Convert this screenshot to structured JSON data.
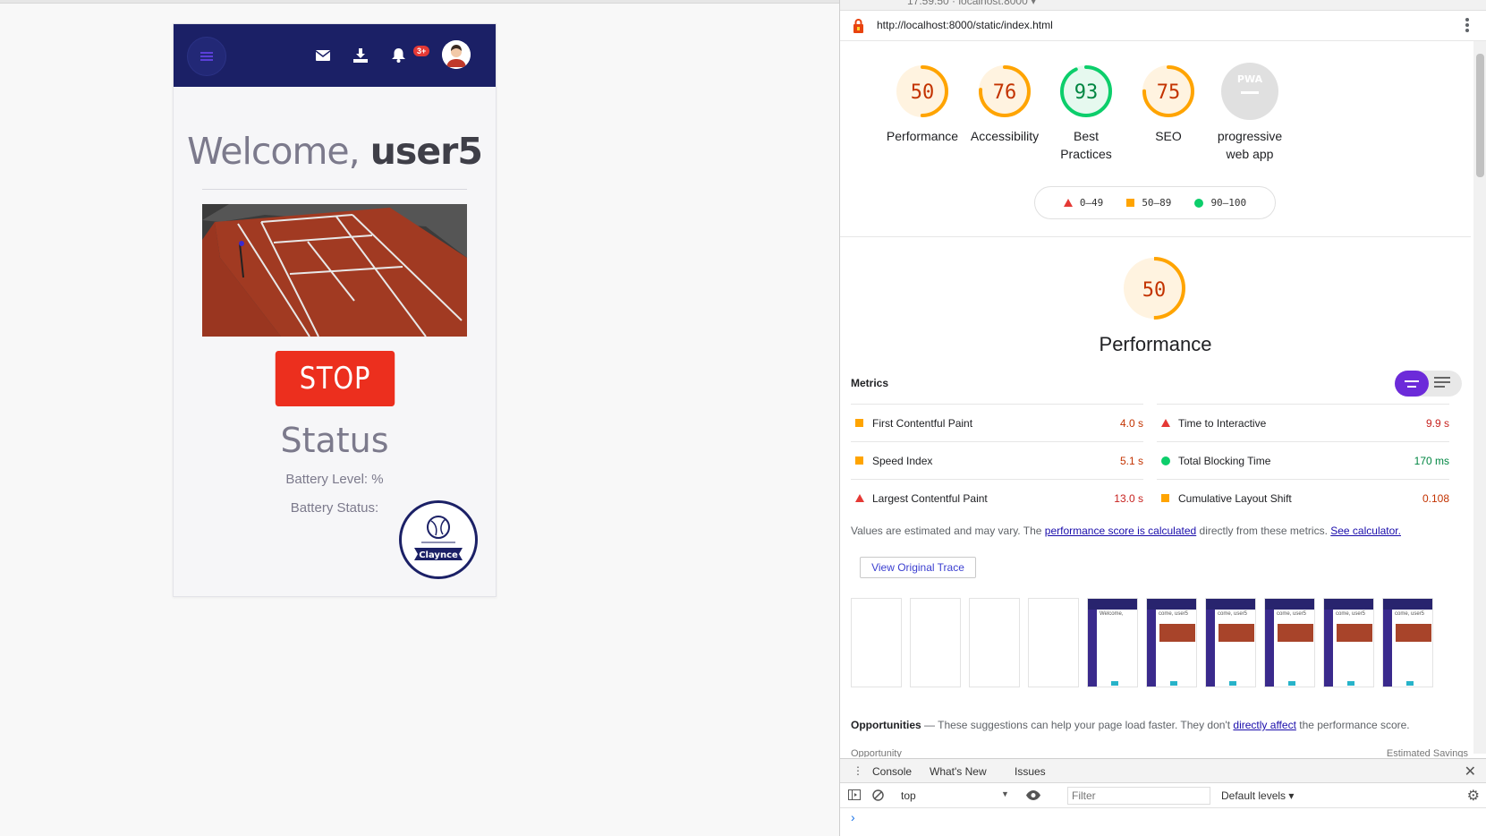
{
  "app": {
    "welcome_prefix": "Welcome,",
    "username": "user5",
    "notification_badge": "3+",
    "stop_label": "STOP",
    "status_title": "Status",
    "battery_level_label": "Battery Level:  %",
    "battery_status_label": "Battery Status:",
    "logo_text": "Claynce",
    "colors": {
      "navbar": "#1b2066",
      "stop": "#ec2f1e"
    }
  },
  "devtools": {
    "url": "http://localhost:8000/static/index.html",
    "top_partial": "17:59:50 · localhost:8000 ▾",
    "scores": [
      {
        "value": 50,
        "label": "Performance",
        "color": "#ffa400"
      },
      {
        "value": 76,
        "label": "Accessibility",
        "color": "#ffa400"
      },
      {
        "value": 93,
        "label": "Best Practices",
        "color": "#0cce6b"
      },
      {
        "value": 75,
        "label": "SEO",
        "color": "#ffa400"
      },
      {
        "value": null,
        "label": "progressive web app",
        "color": "#cccccc",
        "badge": "PWA"
      }
    ],
    "legend": {
      "red": "0–49",
      "orange": "50–89",
      "green": "90–100"
    },
    "performance": {
      "value": 50,
      "title": "Performance"
    },
    "metrics_heading": "Metrics",
    "metrics": [
      {
        "name": "First Contentful Paint",
        "value": "4.0 s",
        "rating": "average"
      },
      {
        "name": "Time to Interactive",
        "value": "9.9 s",
        "rating": "fail"
      },
      {
        "name": "Speed Index",
        "value": "5.1 s",
        "rating": "average"
      },
      {
        "name": "Total Blocking Time",
        "value": "170 ms",
        "rating": "pass"
      },
      {
        "name": "Largest Contentful Paint",
        "value": "13.0 s",
        "rating": "fail"
      },
      {
        "name": "Cumulative Layout Shift",
        "value": "0.108",
        "rating": "average"
      }
    ],
    "note": {
      "prefix": "Values are estimated and may vary. The ",
      "link1": "performance score is calculated",
      "middle": " directly from these metrics. ",
      "link2": "See calculator."
    },
    "trace_button": "View Original Trace",
    "thumbs_text": [
      "Welcome,",
      "come, user5"
    ],
    "opportunities": {
      "title": "Opportunities",
      "dash": " — ",
      "text": "These suggestions can help your page load faster. They don't ",
      "link": "directly affect",
      "suffix": " the performance score.",
      "col_left": "Opportunity",
      "col_right": "Estimated Savings"
    },
    "console": {
      "tabs": [
        "Console",
        "What's New",
        "Issues"
      ],
      "context": "top",
      "filter_placeholder": "Filter",
      "levels": "Default levels ▾",
      "prompt": "›"
    }
  }
}
